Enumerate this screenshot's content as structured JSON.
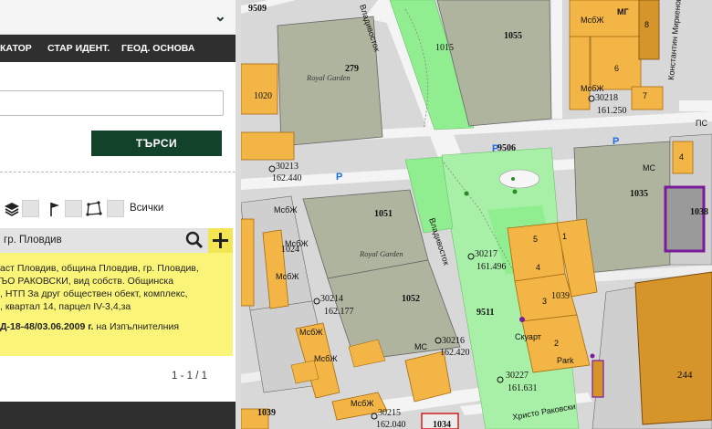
{
  "panel": {
    "top_title": "",
    "tabs": [
      "КАТОР",
      "СТАР ИДЕНТ.",
      "ГЕОД. ОСНОВА"
    ],
    "search_value": "",
    "search_button": "ТЪРСИ",
    "all_label": "Всички",
    "result_text": "гр. Пловдив",
    "info_lines": [
      "аст Пловдив, община Пловдив, гр. Пловдив,",
      "ЪО РАКОВСКИ, вид собств. Общинска",
      ", НТП За друг обществен обект, комплекс,",
      ", квартал 14, парцел IV-3,4,за"
    ],
    "info_order_bold": "Д-18-48/03.06.2009 г.",
    "info_order_rest": " на Изпълнителния",
    "pager": "1 - 1 / 1",
    "colors": {
      "dark_green": "#13422a",
      "yellow": "#faf579",
      "dark_bar": "#2f2f2f"
    }
  },
  "map": {
    "parcels": [
      {
        "id": "279",
        "sub": "Royal Garden"
      },
      {
        "id": "1055"
      },
      {
        "id": "1015"
      },
      {
        "id": "1051",
        "sub": "Royal Garden"
      },
      {
        "id": "1052"
      },
      {
        "id": "1024"
      },
      {
        "id": "1035"
      },
      {
        "id": "1038"
      },
      {
        "id": "1039"
      },
      {
        "id": "1039"
      },
      {
        "id": "1034"
      },
      {
        "id": "244"
      },
      {
        "id": "9509"
      },
      {
        "id": "9506"
      },
      {
        "id": "9511"
      },
      {
        "id": "1020"
      }
    ],
    "points": [
      {
        "id": "30213",
        "elev": "162.440"
      },
      {
        "id": "30214",
        "elev": "162.177"
      },
      {
        "id": "30217",
        "elev": "161.496"
      },
      {
        "id": "30216",
        "elev": "162.420"
      },
      {
        "id": "30215",
        "elev": "162.040"
      },
      {
        "id": "30227",
        "elev": "161.631"
      },
      {
        "id": "30218",
        "elev": "161.250"
      }
    ],
    "streets": [
      "Владивосток",
      "Христо Раковски",
      "Константин Миркенов",
      "ПС"
    ],
    "markers": [
      "МсбЖ",
      "МС",
      "МГ",
      "Скуарт",
      "Park"
    ],
    "parking_label": "P",
    "block_numbers": [
      "1",
      "2",
      "3",
      "4",
      "5",
      "6",
      "7",
      "8"
    ],
    "colors": {
      "building": "#f2b546",
      "green": "#90ee90",
      "gray_parcel": "#aeb49e",
      "road": "#f2f2f2",
      "block": "#d4d4d4",
      "highlight": "#7a1b9a",
      "big_building": "#d6952b"
    }
  }
}
